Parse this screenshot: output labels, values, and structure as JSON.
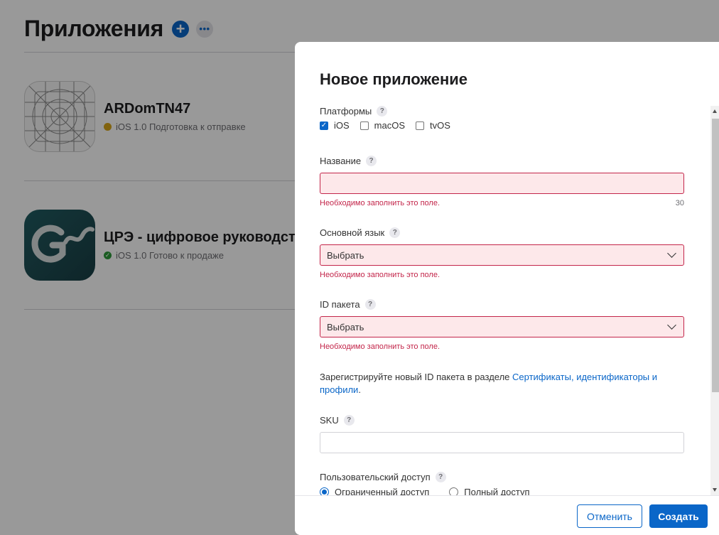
{
  "background": {
    "title": "Приложения",
    "add_icon": "plus-icon",
    "more_icon": "ellipsis-icon",
    "apps": [
      {
        "name": "ARDomTN47",
        "status": "iOS 1.0 Подготовка к отправке",
        "status_color": "#d7a51a",
        "icon": "app-placeholder-icon"
      },
      {
        "name": "ЦРЭ - цифровое руководст",
        "status": "iOS 1.0 Готово к продаже",
        "status_color": "#2e9a3a",
        "icon": "app-logo-icon"
      }
    ]
  },
  "modal": {
    "title": "Новое приложение",
    "platforms": {
      "label": "Платформы",
      "options": [
        {
          "label": "iOS",
          "checked": true
        },
        {
          "label": "macOS",
          "checked": false
        },
        {
          "label": "tvOS",
          "checked": false
        }
      ]
    },
    "name": {
      "label": "Название",
      "value": "",
      "error": "Необходимо заполнить это поле.",
      "counter": "30"
    },
    "language": {
      "label": "Основной язык",
      "value": "Выбрать",
      "error": "Необходимо заполнить это поле."
    },
    "bundle": {
      "label": "ID пакета",
      "value": "Выбрать",
      "error": "Необходимо заполнить это поле."
    },
    "hint": {
      "text": "Зарегистрируйте новый ID пакета в разделе ",
      "link": "Сертификаты, идентификаторы и профили",
      "suffix": "."
    },
    "sku": {
      "label": "SKU",
      "value": ""
    },
    "access": {
      "label": "Пользовательский доступ",
      "options": [
        {
          "label": "Ограниченный доступ",
          "selected": true
        },
        {
          "label": "Полный доступ",
          "selected": false
        }
      ]
    },
    "help_glyph": "?",
    "buttons": {
      "cancel": "Отменить",
      "create": "Создать"
    }
  },
  "colors": {
    "accent": "#0a66c8",
    "error": "#c3254a",
    "error_bg": "#fde8ea"
  }
}
